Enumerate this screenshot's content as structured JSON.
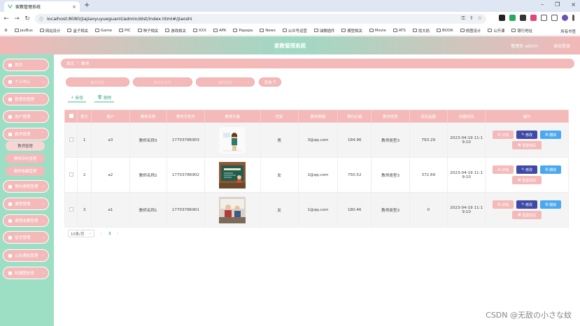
{
  "browser": {
    "tab_title": "家教管理系统",
    "url": "localhost:8080/jiajiaoyuyueguanli/admin/dist/index.html#/jiaoshi",
    "bookmarks": [
      "JavBus",
      "网站设计",
      "盒子相关",
      "Game",
      "PIC",
      "种子相关",
      "游戏相关",
      "XXX",
      "APK",
      "Papapa",
      "News",
      "公众号运营",
      "油猴插件",
      "模型相关",
      "Movie",
      "ATS",
      "找大妈",
      "BOOK",
      "修图设计",
      "公开课",
      "银行地址"
    ],
    "bookmarks_right": "所有书签"
  },
  "header": {
    "title": "家教管理系统",
    "user": "管理员 admin",
    "logout": "退出登录"
  },
  "sidebar": {
    "items": [
      {
        "label": "首页"
      },
      {
        "label": "个人中心"
      },
      {
        "label": "管理员管理"
      },
      {
        "label": "用户管理"
      },
      {
        "label": "教师管理"
      },
      {
        "label": "预约课程管理"
      },
      {
        "label": "课程管理"
      },
      {
        "label": "课程收藏管理"
      },
      {
        "label": "留言管理"
      },
      {
        "label": "公告通知管理"
      },
      {
        "label": "轮播图信息"
      }
    ],
    "submenu": [
      "教师管理",
      "教师评价管理",
      "教师收藏管理"
    ]
  },
  "breadcrumb": {
    "home": "首页",
    "sep": "/",
    "current": "教师"
  },
  "filters": {
    "f1": "教师名称",
    "f2": "教师手机号",
    "f3": "教师类型",
    "search": "查询"
  },
  "actions": {
    "add": "新增",
    "delete": "删除"
  },
  "table": {
    "headers": [
      "",
      "索引",
      "账户",
      "教师名称",
      "教师手机号",
      "教师头像",
      "性别",
      "教师邮箱",
      "预约价格",
      "教师类型",
      "现有金额",
      "创建时间",
      "操作"
    ],
    "rows": [
      {
        "idx": "1",
        "account": "a3",
        "name": "教师名称3",
        "phone": "17703786903",
        "gender": "男",
        "email": "3@qq.com",
        "price": "184.96",
        "type": "教师类型3",
        "balance": "763.29",
        "created_l1": "2023-04-19 11:1",
        "created_l2": "9:10"
      },
      {
        "idx": "2",
        "account": "a2",
        "name": "教师名称2",
        "phone": "17703786902",
        "gender": "女",
        "email": "2@qq.com",
        "price": "750.52",
        "type": "教师类型3",
        "balance": "372.69",
        "created_l1": "2023-04-19 11:1",
        "created_l2": "9:10"
      },
      {
        "idx": "3",
        "account": "a1",
        "name": "教师名称1",
        "phone": "17703786901",
        "gender": "女",
        "email": "1@qq.com",
        "price": "180.46",
        "type": "教师类型3",
        "balance": "0",
        "created_l1": "2023-04-19 11:1",
        "created_l2": "9:10"
      }
    ],
    "ops": {
      "detail": "详情",
      "edit": "修改",
      "delete": "删除",
      "reset": "重置密码"
    }
  },
  "pager": {
    "size": "10条/页",
    "prev": "‹",
    "page": "1",
    "next": "›"
  },
  "watermark": "CSDN @无敌の小さな蚊",
  "colors": {
    "pink": "#f4b9b9",
    "mint": "#9ddfc4",
    "edit": "#3f4aa8",
    "delete": "#4aa8f0"
  }
}
